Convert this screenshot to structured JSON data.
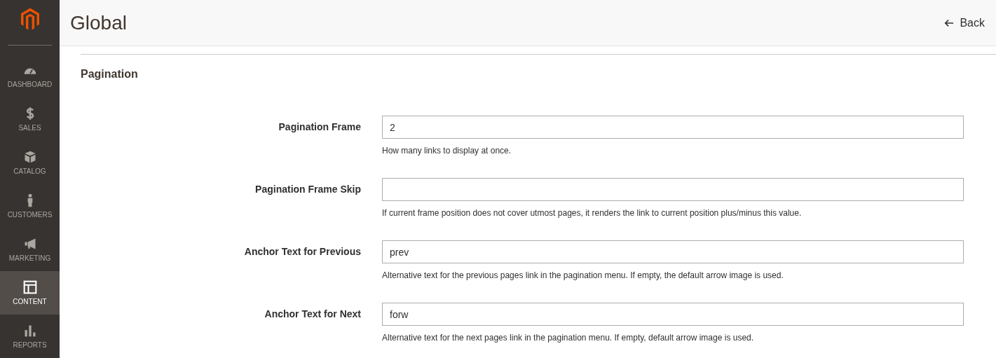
{
  "sidebar": {
    "items": [
      {
        "label": "DASHBOARD",
        "selected": false
      },
      {
        "label": "SALES",
        "selected": false
      },
      {
        "label": "CATALOG",
        "selected": false
      },
      {
        "label": "CUSTOMERS",
        "selected": false
      },
      {
        "label": "MARKETING",
        "selected": false
      },
      {
        "label": "CONTENT",
        "selected": true
      },
      {
        "label": "REPORTS",
        "selected": false
      }
    ]
  },
  "header": {
    "title": "Global",
    "back": "Back"
  },
  "section": {
    "title": "Pagination",
    "fields": [
      {
        "label": "Pagination Frame",
        "value": "2",
        "note": "How many links to display at once."
      },
      {
        "label": "Pagination Frame Skip",
        "note": "If current frame position does not cover utmost pages, it renders the link to current position plus/minus this value."
      },
      {
        "label": "Anchor Text for Previous",
        "value": "prev",
        "note": "Alternative text for the previous pages link in the pagination menu. If empty, the default arrow image is used."
      },
      {
        "label": "Anchor Text for Next",
        "value": "forw",
        "note": "Alternative text for the next pages link in the pagination menu. If empty, default arrow image is used."
      }
    ]
  }
}
